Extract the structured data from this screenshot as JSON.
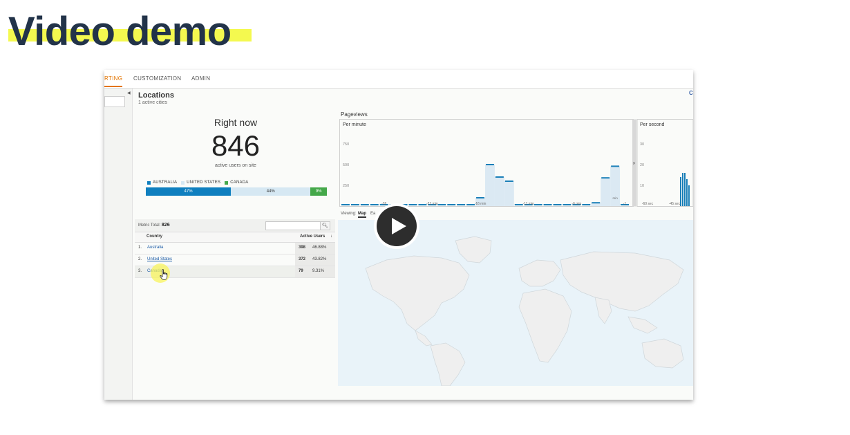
{
  "slide": {
    "title": "Video demo"
  },
  "nav": {
    "items": [
      "RTING",
      "CUSTOMIZATION",
      "ADMIN"
    ],
    "active_index": 0
  },
  "locations": {
    "title": "Locations",
    "subtitle": "1 active cities",
    "corner_label": "C"
  },
  "right_now": {
    "label": "Right now",
    "value": "846",
    "sublabel": "active users on site"
  },
  "country_share": {
    "legend": [
      "AUSTRALIA",
      "UNITED STATES",
      "CANADA"
    ],
    "segments": [
      {
        "label": "47%",
        "value": 47,
        "color": "#0f7fbf"
      },
      {
        "label": "44%",
        "value": 44,
        "color": "#d6e8f3"
      },
      {
        "label": "9%",
        "value": 9,
        "color": "#44a84a"
      }
    ]
  },
  "pageviews": {
    "title": "Pageviews"
  },
  "chart_data": [
    {
      "type": "bar",
      "title": "Per minute",
      "x_tick_labels": [
        "-26",
        "-21 min",
        "-16 min",
        "-11 min",
        "-6 min",
        "-1"
      ],
      "x_tick_minutes": [
        -26,
        -21,
        -16,
        -11,
        -6,
        -1
      ],
      "y_ticks": [
        250,
        500,
        750
      ],
      "ylim": [
        0,
        1000
      ],
      "x": [
        -30,
        -29,
        -28,
        -27,
        -26,
        -25,
        -24,
        -23,
        -22,
        -21,
        -20,
        -19,
        -18,
        -17,
        -16,
        -15,
        -14,
        -13,
        -12,
        -11,
        -10,
        -9,
        -8,
        -7,
        -6,
        -5,
        -4,
        -3,
        -2,
        -1
      ],
      "values": [
        0,
        0,
        0,
        0,
        0,
        0,
        0,
        0,
        0,
        0,
        0,
        0,
        0,
        0,
        100,
        500,
        350,
        300,
        0,
        0,
        0,
        0,
        0,
        0,
        0,
        0,
        40,
        340,
        480,
        0
      ],
      "small_label": "min"
    },
    {
      "type": "bar",
      "title": "Per second",
      "x_tick_labels": [
        "-60 sec",
        "-45 sec"
      ],
      "y_ticks": [
        10,
        20,
        30
      ],
      "ylim": [
        0,
        40
      ],
      "x": [
        -42,
        -41,
        -40,
        -39,
        -38
      ],
      "values": [
        14,
        16,
        16,
        13,
        10
      ]
    }
  ],
  "metric": {
    "label": "Metric Total:",
    "value": "826",
    "search_icon": "search-icon"
  },
  "table": {
    "columns": [
      "Country",
      "Active Users"
    ],
    "rows": [
      {
        "rank": "1.",
        "country": "Australia",
        "users": "398",
        "pct": "46.88%"
      },
      {
        "rank": "2.",
        "country": "United States",
        "users": "372",
        "pct": "43.82%"
      },
      {
        "rank": "3.",
        "country": "Canada",
        "users": "79",
        "pct": "9.31%"
      }
    ]
  },
  "map": {
    "viewing_label": "Viewing:",
    "tab_map": "Map",
    "tab_earth": "Ea"
  },
  "video": {
    "play_icon": "play-icon"
  }
}
